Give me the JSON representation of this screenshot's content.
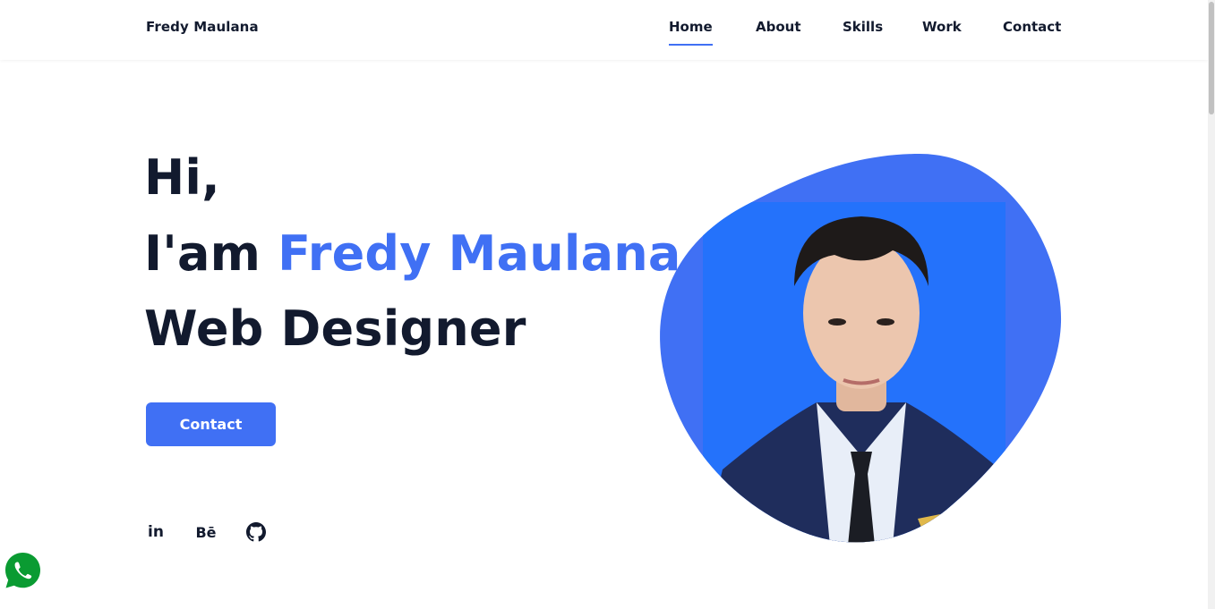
{
  "header": {
    "logo": "Fredy Maulana",
    "nav": [
      {
        "label": "Home",
        "active": true
      },
      {
        "label": "About",
        "active": false
      },
      {
        "label": "Skills",
        "active": false
      },
      {
        "label": "Work",
        "active": false
      },
      {
        "label": "Contact",
        "active": false
      }
    ]
  },
  "hero": {
    "greeting": "Hi,",
    "intro_prefix": "I'am",
    "name": "Fredy Maulana",
    "role": "Web Designer",
    "button_label": "Contact"
  },
  "social": {
    "linkedin_label": "in",
    "behance_label": "Bē",
    "icons": [
      "linkedin-icon",
      "behance-icon",
      "github-icon"
    ]
  },
  "floating": {
    "icon": "whatsapp-icon"
  },
  "colors": {
    "accent": "#4070f4",
    "heading": "#121a2e",
    "photo_bg": "#2472fb",
    "whatsapp": "#0a9b32"
  }
}
